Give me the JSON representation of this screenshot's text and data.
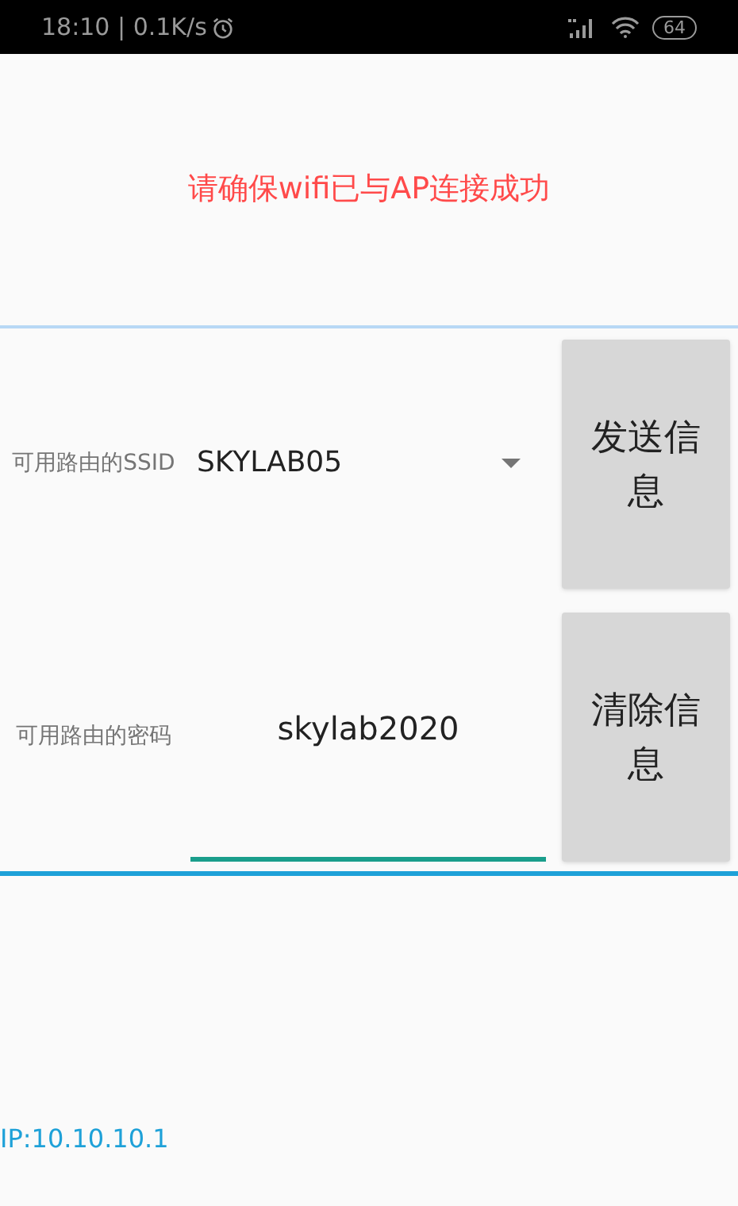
{
  "status_bar": {
    "time_speed": "18:10 | 0.1K/s",
    "battery": "64"
  },
  "notice": "请确保wifi已与AP连接成功",
  "rows": [
    {
      "kind": "dropdown",
      "label": "可用路由的SSID",
      "value": "SKYLAB05",
      "button": "发送信息"
    },
    {
      "kind": "input",
      "label": "可用路由的密码",
      "value": "skylab2020",
      "button": "清除信息"
    }
  ],
  "ip": "IP:10.10.10.1"
}
